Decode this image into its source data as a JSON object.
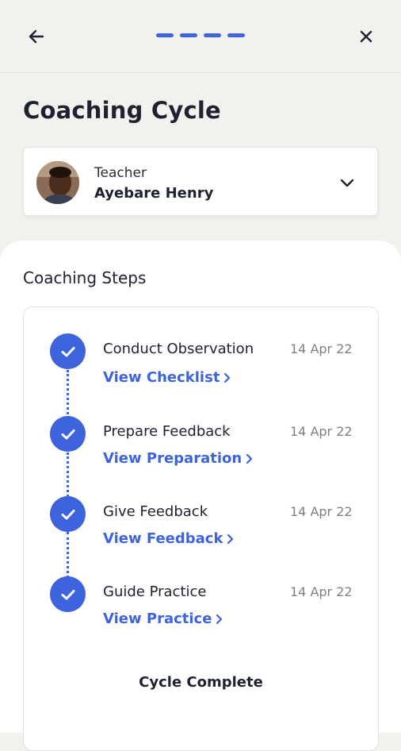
{
  "header": {
    "back_icon": "arrow-left-icon",
    "close_icon": "close-icon",
    "progress_segments": 4,
    "progress_completed": 4,
    "accent_color": "#3d63dd"
  },
  "page": {
    "title": "Coaching Cycle"
  },
  "teacher": {
    "role_label": "Teacher",
    "name": "Ayebare Henry",
    "dropdown_icon": "chevron-down-icon"
  },
  "coaching": {
    "section_title": "Coaching Steps",
    "steps": [
      {
        "title": "Conduct Observation",
        "date": "14 Apr 22",
        "link": "View Checklist",
        "status": "completed"
      },
      {
        "title": "Prepare Feedback",
        "date": "14 Apr 22",
        "link": "View Preparation",
        "status": "completed"
      },
      {
        "title": "Give Feedback",
        "date": "14 Apr 22",
        "link": "View Feedback",
        "status": "completed"
      },
      {
        "title": "Guide Practice",
        "date": "14 Apr 22",
        "link": "View Practice",
        "status": "completed"
      }
    ],
    "footer": "Cycle Complete"
  }
}
